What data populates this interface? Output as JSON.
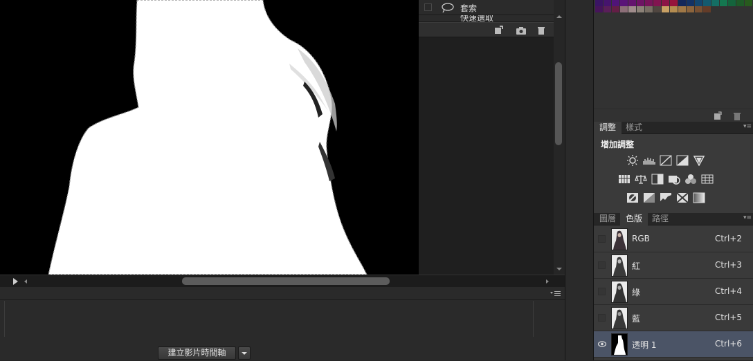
{
  "history": {
    "items": [
      {
        "label": "套索",
        "icon": "lasso-icon"
      },
      {
        "label": "快速選取",
        "icon": "quick-select-icon"
      }
    ],
    "toolbar": [
      "new-document-from-state-icon",
      "camera-icon",
      "trash-icon"
    ]
  },
  "timeline": {
    "create_label": "建立影片時間軸",
    "dropdown_icon": "chevron-down-icon"
  },
  "swatches": {
    "row1": [
      "#3a1464",
      "#46146e",
      "#501478",
      "#5a1478",
      "#64146e",
      "#6e1464",
      "#78145a",
      "#821450",
      "#8c1446",
      "#96143c",
      "#14285a",
      "#143264",
      "#14466e",
      "#145a6e",
      "#146e64",
      "#147850",
      "#14643c",
      "#1e5a28",
      "#285a1e",
      "#3c5a14",
      "#5a5014",
      "#64461e"
    ],
    "row2": [
      "#46145a",
      "#5a1e5a",
      "#641e46",
      "#8c6e78",
      "#a08c8c",
      "#8c8278",
      "#786e64",
      "#504640",
      "#c8a064",
      "#b48c50",
      "#a07846",
      "#8c643c",
      "#785032",
      "#643c28"
    ]
  },
  "adjustments": {
    "tabs": [
      "調整",
      "樣式"
    ],
    "active_tab": "調整",
    "title": "增加調整",
    "row1": [
      "brightness-icon",
      "levels-icon",
      "curves-icon",
      "exposure-icon",
      "vibrance-icon"
    ],
    "row2": [
      "hue-saturation-icon",
      "color-balance-icon",
      "black-white-icon",
      "photo-filter-icon",
      "channel-mixer-icon",
      "color-lookup-icon"
    ],
    "row3": [
      "invert-icon",
      "posterize-icon",
      "threshold-icon",
      "selective-color-icon",
      "gradient-map-icon"
    ]
  },
  "channels_panel": {
    "tabs": [
      "圖層",
      "色版",
      "路徑"
    ],
    "active_tab": "色版",
    "rows": [
      {
        "name": "RGB",
        "shortcut": "Ctrl+2",
        "visible": false,
        "selected": false
      },
      {
        "name": "紅",
        "shortcut": "Ctrl+3",
        "visible": false,
        "selected": false
      },
      {
        "name": "綠",
        "shortcut": "Ctrl+4",
        "visible": false,
        "selected": false
      },
      {
        "name": "藍",
        "shortcut": "Ctrl+5",
        "visible": false,
        "selected": false
      },
      {
        "name": "透明 1",
        "shortcut": "Ctrl+6",
        "visible": true,
        "selected": true
      }
    ]
  }
}
